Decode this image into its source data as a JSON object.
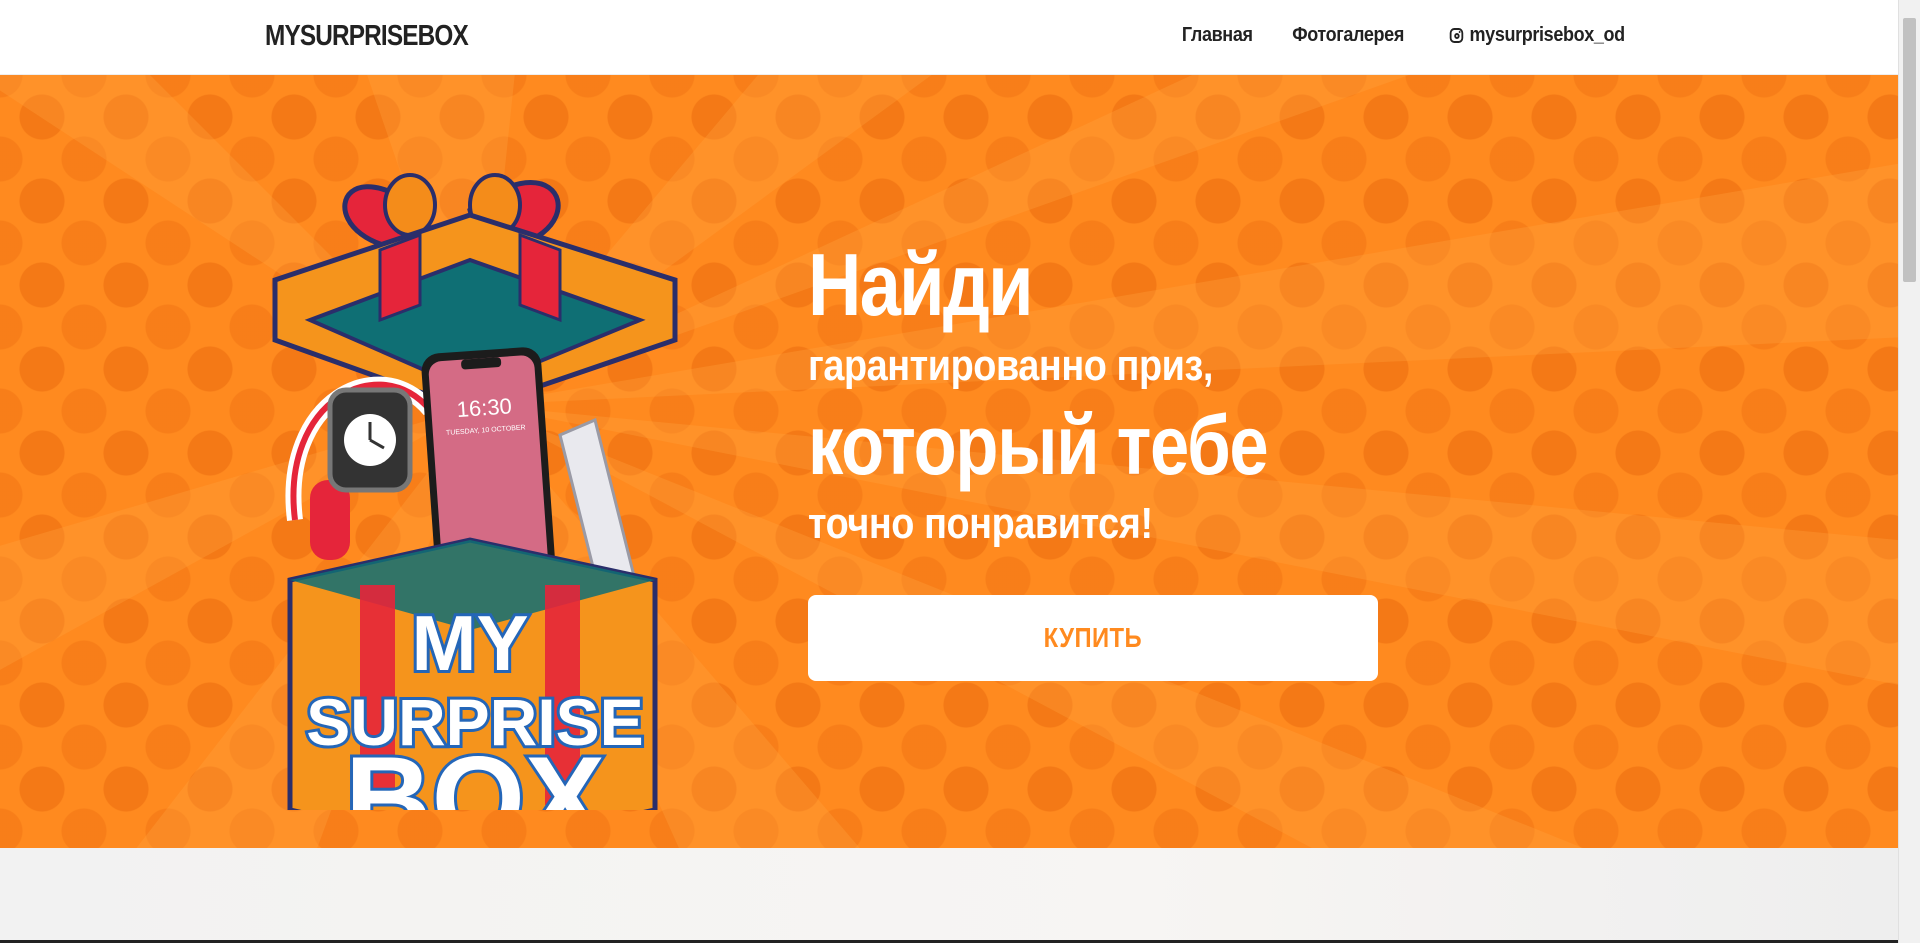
{
  "header": {
    "brand": "MYSURPRISEBOX",
    "nav": [
      {
        "label": "Главная"
      },
      {
        "label": "Фотогалерея"
      },
      {
        "label": "mysurprisebox_od",
        "icon": "instagram-icon"
      }
    ]
  },
  "hero": {
    "line1": "Найди",
    "line2": "гарантированно приз,",
    "line3": "который тебе",
    "line4": "точно понравится!",
    "buy_label": "КУПИТЬ",
    "phone_time": "16:30",
    "phone_date": "TUESDAY, 10 OCTOBER",
    "logo_text": [
      "MY",
      "SURPRISE",
      "BOX"
    ]
  },
  "colors": {
    "accent": "#ff8a1f",
    "background_dots": "#e8701a",
    "white": "#ffffff",
    "text_dark": "#222222"
  }
}
